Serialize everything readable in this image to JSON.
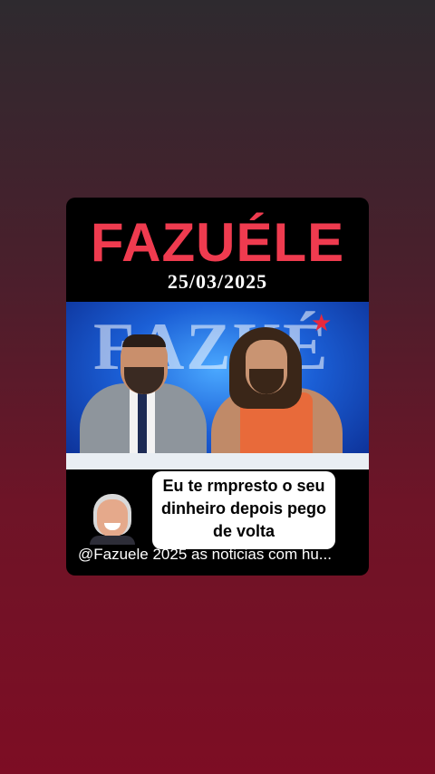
{
  "post": {
    "title": "FAZUÉLE",
    "date": "25/03/2025",
    "caption": "Eu te rmpresto o seu\ndinheiro  depois pego\nde volta",
    "footer_text": "@Fazuele 2025 as noticias com hu..."
  },
  "colors": {
    "title": "#ef3b4f",
    "background_top": "#2e2a2f",
    "background_bottom": "#7d0d24"
  }
}
